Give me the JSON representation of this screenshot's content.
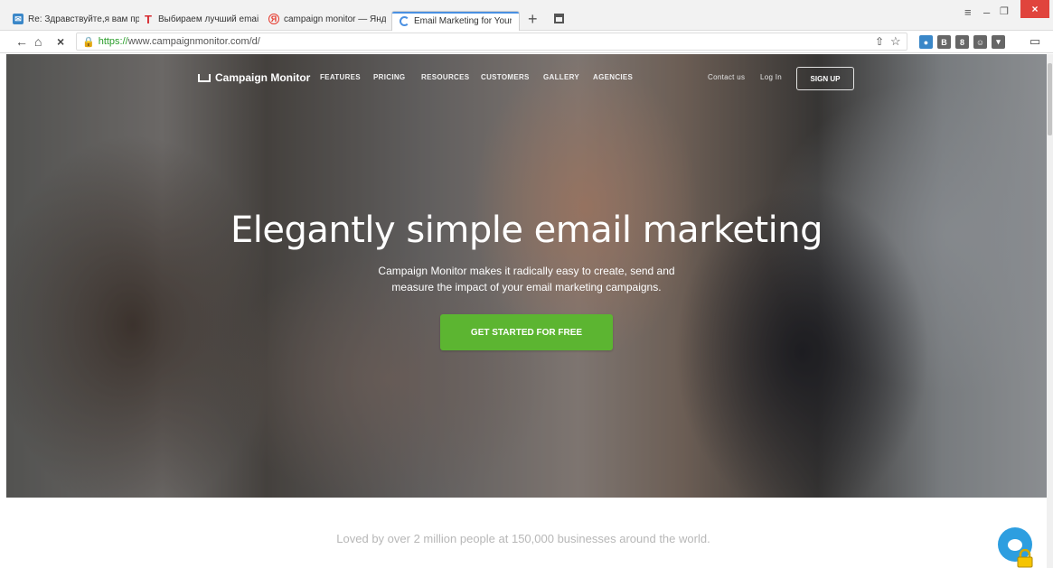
{
  "browser": {
    "tabs": [
      {
        "title": "Re: Здравствуйте,я вам прис",
        "icon": "mail-icon",
        "color": "#3a87c8"
      },
      {
        "title": "Выбираем лучший email-се",
        "icon": "t-icon",
        "color": "#d6282e"
      },
      {
        "title": "campaign monitor — Яндекс",
        "icon": "yandex-icon",
        "color": "#e63b2e"
      },
      {
        "title": "Email Marketing for Your Bu",
        "icon": "loading-icon",
        "color": "#4a90e2"
      }
    ],
    "url_protocol": "https://",
    "url_rest": "www.campaignmonitor.com/d/"
  },
  "nav": {
    "brand": "Campaign Monitor",
    "links": [
      "FEATURES",
      "PRICING",
      "RESOURCES",
      "CUSTOMERS",
      "GALLERY",
      "AGENCIES"
    ],
    "contact": "Contact us",
    "login": "Log In",
    "signup": "SIGN UP"
  },
  "hero": {
    "headline": "Elegantly simple email marketing",
    "sub_line1": "Campaign Monitor makes it radically easy to create, send and",
    "sub_line2": "measure the impact of your email marketing campaigns.",
    "cta": "GET STARTED FOR FREE"
  },
  "tagline": "Loved by over 2 million people at 150,000 businesses around the world.",
  "colors": {
    "cta": "#5cb531",
    "chat": "#2d9ee0"
  }
}
